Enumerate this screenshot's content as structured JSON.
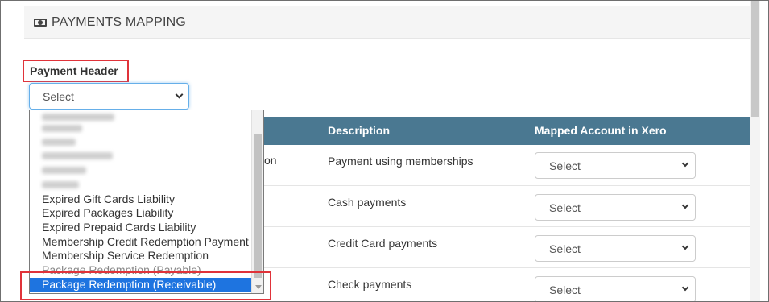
{
  "section": {
    "title": "PAYMENTS MAPPING",
    "icon": "money-icon"
  },
  "payment_header": {
    "label": "Payment Header",
    "select_value": "Select"
  },
  "table": {
    "headers": {
      "description": "Description",
      "mapped": "Mapped Account in Xero"
    },
    "partial_cell": "on",
    "rows": [
      {
        "description": "Payment using memberships",
        "select_value": "Select"
      },
      {
        "description": "Cash payments",
        "select_value": "Select"
      },
      {
        "description": "Credit Card payments",
        "select_value": "Select"
      },
      {
        "description": "Check payments",
        "select_value": "Select"
      }
    ]
  },
  "dropdown": {
    "items": [
      "Expired Gift Cards Liability",
      "Expired Packages Liability",
      "Expired Prepaid Cards Liability",
      "Membership Credit Redemption Payment",
      "Membership Service Redemption",
      "Package Redemption (Payable)",
      "Package Redemption (Receivable)"
    ]
  },
  "colors": {
    "table_header": "#4a7891",
    "highlight": "#e0333a",
    "selected": "#1e74e0"
  }
}
